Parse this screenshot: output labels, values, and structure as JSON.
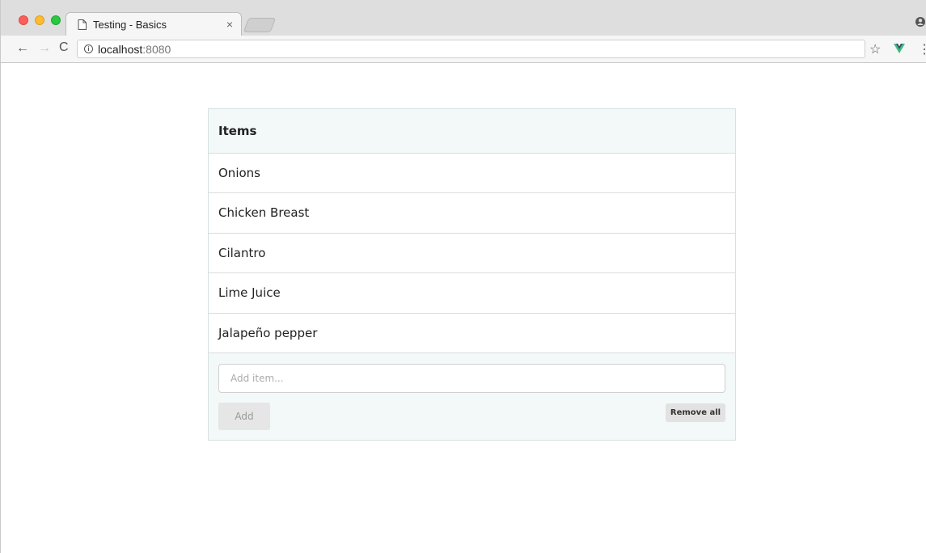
{
  "browser": {
    "tab_title": "Testing - Basics",
    "tab_close": "×",
    "url_host": "localhost",
    "url_port": ":8080",
    "nav": {
      "back": "←",
      "forward": "→",
      "reload": "C"
    },
    "star": "☆",
    "menu": "⋮"
  },
  "list": {
    "heading": "Items",
    "items": [
      "Onions",
      "Chicken Breast",
      "Cilantro",
      "Lime Juice",
      "Jalapeño pepper"
    ]
  },
  "form": {
    "placeholder": "Add item...",
    "add_label": "Add",
    "remove_all_label": "Remove all"
  },
  "colors": {
    "panel_bg": "#f3f8f8",
    "vue_green": "#41b883",
    "vue_dark": "#35495e"
  }
}
